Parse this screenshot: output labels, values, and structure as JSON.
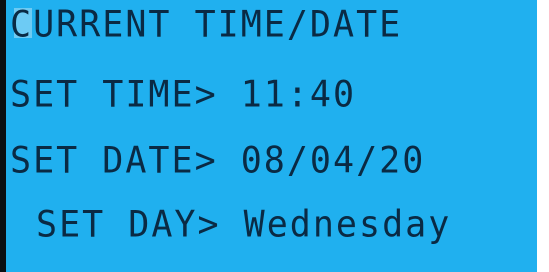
{
  "display": {
    "line1": "CURRENT TIME/DATE",
    "line2": "SET TIME> 11:40",
    "line3": "SET DATE> 08/04/20",
    "line4": "SET DAY> Wednesday"
  },
  "colors": {
    "screen_background": "#20b0ef",
    "text": "#0a2a44"
  }
}
